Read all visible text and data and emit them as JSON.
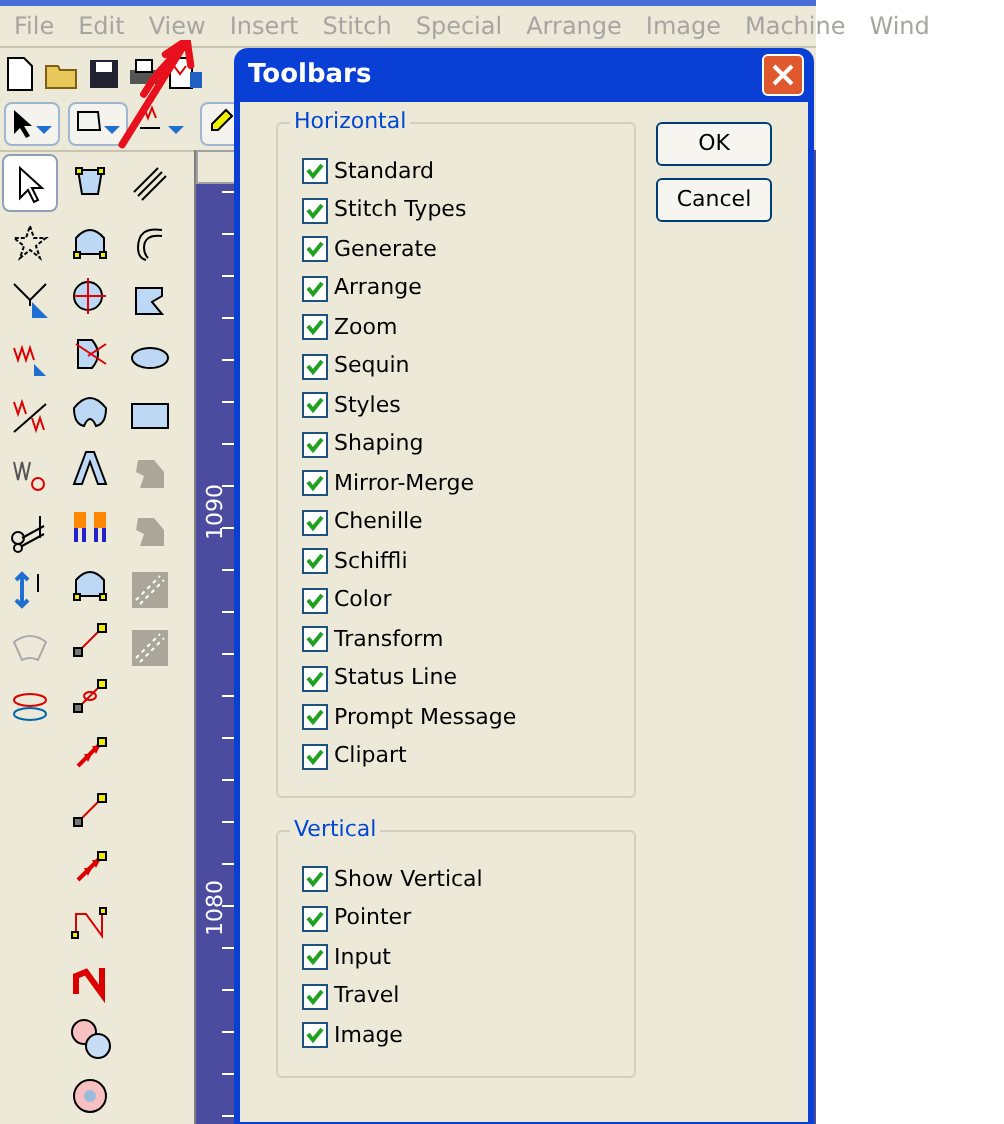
{
  "menu": [
    {
      "label": "File",
      "disabled": true
    },
    {
      "label": "Edit",
      "disabled": true
    },
    {
      "label": "View",
      "disabled": true
    },
    {
      "label": "Insert",
      "disabled": true
    },
    {
      "label": "Stitch",
      "disabled": true
    },
    {
      "label": "Special",
      "disabled": true
    },
    {
      "label": "Arrange",
      "disabled": true
    },
    {
      "label": "Image",
      "disabled": true
    },
    {
      "label": "Machine",
      "disabled": true
    },
    {
      "label": "Wind",
      "disabled": true
    }
  ],
  "ruler_labels": [
    "1090",
    "1080"
  ],
  "dialog": {
    "title": "Toolbars",
    "groups": [
      {
        "title": "Horizontal",
        "items": [
          {
            "label": "Standard",
            "checked": true
          },
          {
            "label": "Stitch Types",
            "checked": true
          },
          {
            "label": "Generate",
            "checked": true
          },
          {
            "label": "Arrange",
            "checked": true
          },
          {
            "label": "Zoom",
            "checked": true
          },
          {
            "label": "Sequin",
            "checked": true
          },
          {
            "label": "Styles",
            "checked": true
          },
          {
            "label": "Shaping",
            "checked": true
          },
          {
            "label": "Mirror-Merge",
            "checked": true
          },
          {
            "label": "Chenille",
            "checked": true
          },
          {
            "label": "Schiffli",
            "checked": true
          },
          {
            "label": "Color",
            "checked": true
          },
          {
            "label": "Transform",
            "checked": true
          },
          {
            "label": "Status Line",
            "checked": true
          },
          {
            "label": "Prompt Message",
            "checked": true
          },
          {
            "label": "Clipart",
            "checked": true
          }
        ]
      },
      {
        "title": "Vertical",
        "items": [
          {
            "label": "Show Vertical",
            "checked": true
          },
          {
            "label": "Pointer",
            "checked": true
          },
          {
            "label": "Input",
            "checked": true
          },
          {
            "label": "Travel",
            "checked": true
          },
          {
            "label": "Image",
            "checked": true
          }
        ]
      }
    ],
    "buttons": [
      "OK",
      "Cancel"
    ]
  }
}
